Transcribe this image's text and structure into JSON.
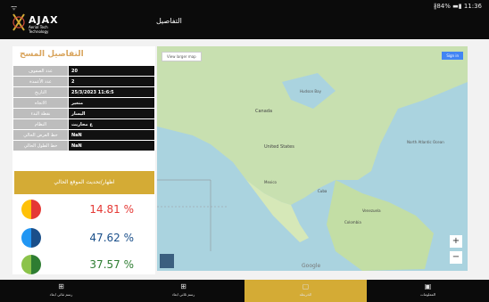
{
  "status": {
    "left": "ᯤ",
    "right": "∦84% ▬▮ 11:36"
  },
  "app": {
    "logo_text": "AJAX",
    "logo_sub": "Aerial Tech Technology",
    "title": "التفاصيل"
  },
  "panel": {
    "title": "التفاصيل المسح",
    "rows": [
      {
        "label": "عدد الصفوف",
        "value": "20"
      },
      {
        "label": "عدد الأعمدة",
        "value": "2"
      },
      {
        "label": "التاريخ",
        "value": "25/3/2023 11:6:5"
      },
      {
        "label": "الاتجاه",
        "value": "متغير"
      },
      {
        "label": "نقطة البدء",
        "value": "اليسار"
      },
      {
        "label": "النظام",
        "value": "ع محاريث"
      },
      {
        "label": "خط العرض الحالي",
        "value": "NaN"
      },
      {
        "label": "خط الطول الحالي",
        "value": "NaN"
      }
    ],
    "button_label": "اظهار/تحديث الموقع الحالي",
    "stats": [
      {
        "pct": "14.81 %",
        "color": "#e53935",
        "accent": "#ffc107"
      },
      {
        "pct": "47.62 %",
        "color": "#1a4f8a",
        "accent": "#2196f3"
      },
      {
        "pct": "37.57 %",
        "color": "#2e7d32",
        "accent": "#8bc34a"
      }
    ]
  },
  "map": {
    "tag": "View larger map",
    "signin": "Sign in",
    "zoom_in": "+",
    "zoom_out": "−",
    "google": "Google",
    "labels": [
      "Hudson Bay",
      "Canada",
      "United States",
      "Mexico",
      "Cuba",
      "Venezuela",
      "Colombia",
      "North Atlantic Ocean"
    ]
  },
  "tabs": [
    {
      "icon": "grid-icon",
      "label": "رسم ثنائي ابعاد"
    },
    {
      "icon": "grid-icon",
      "label": "رسم ثلاثي ابعاد"
    },
    {
      "icon": "map-icon",
      "label": "الخريطة"
    },
    {
      "icon": "info-icon",
      "label": "المعلومات"
    }
  ]
}
